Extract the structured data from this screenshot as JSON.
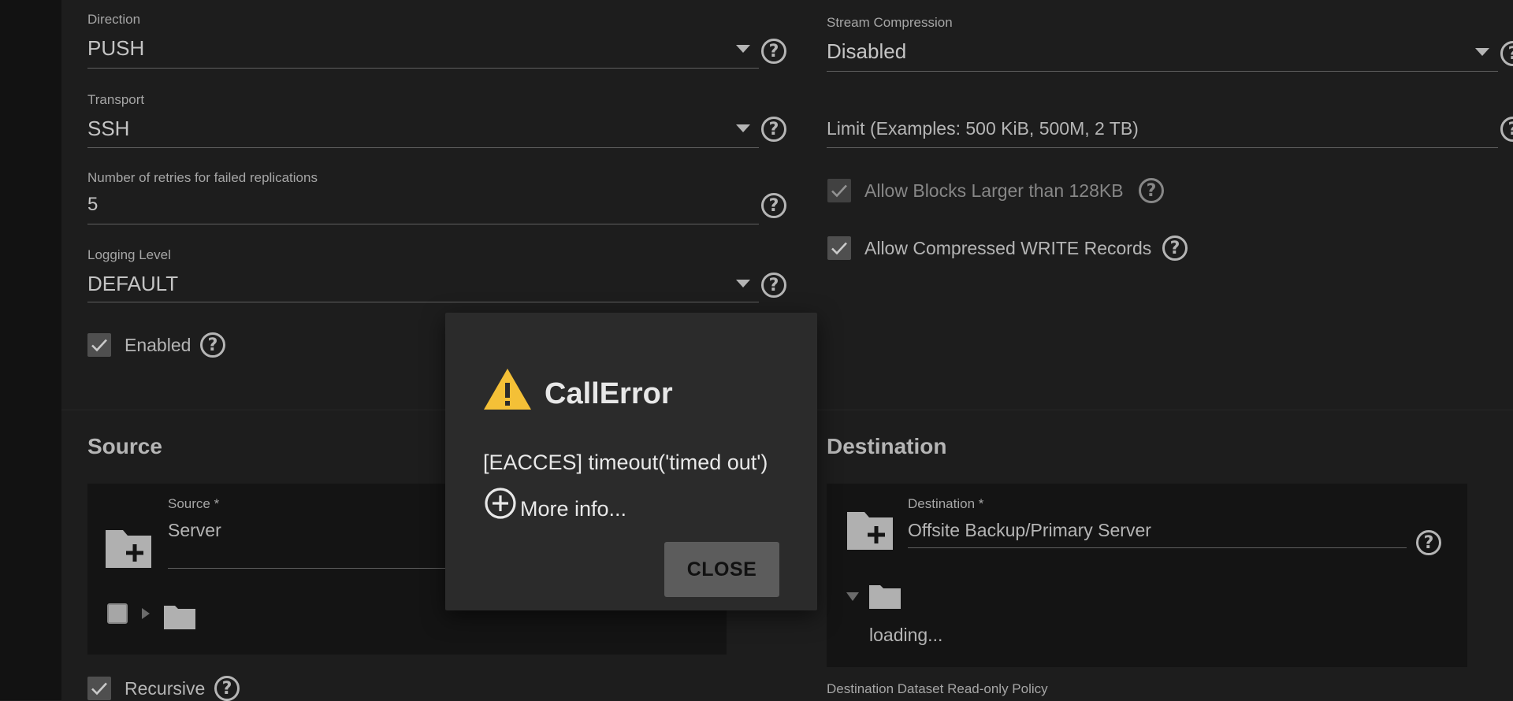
{
  "general": {
    "direction": {
      "label": "Direction",
      "value": "PUSH"
    },
    "transport": {
      "label": "Transport",
      "value": "SSH"
    },
    "retries": {
      "label": "Number of retries for failed replications",
      "value": "5"
    },
    "logging": {
      "label": "Logging Level",
      "value": "DEFAULT"
    },
    "enabled": {
      "label": "Enabled",
      "checked": true
    }
  },
  "compression": {
    "stream": {
      "label": "Stream Compression",
      "value": "Disabled"
    },
    "limit": {
      "placeholder": "Limit (Examples: 500 KiB, 500M, 2 TB)"
    },
    "large_blocks": {
      "label": "Allow Blocks Larger than 128KB",
      "checked": true,
      "disabled": true
    },
    "compressed_write": {
      "label": "Allow Compressed WRITE Records",
      "checked": true
    }
  },
  "source": {
    "title": "Source",
    "field_label": "Source *",
    "field_value": "Server",
    "recursive": {
      "label": "Recursive",
      "checked": true
    }
  },
  "destination": {
    "title": "Destination",
    "field_label": "Destination *",
    "field_value": "Offsite Backup/Primary Server",
    "loading_text": "loading...",
    "readonly_policy_label": "Destination Dataset Read-only Policy"
  },
  "dialog": {
    "title": "CallError",
    "message": "[EACCES] timeout('timed out')",
    "more_info": "More info...",
    "close_label": "CLOSE"
  },
  "colors": {
    "background": "#212121",
    "dialog": "#2b2b2b",
    "warning": "#f4c037",
    "button": "#5c5c5c"
  },
  "icons": {
    "help": "?",
    "dialog": "warning-icon",
    "more_info": "plus-circle-icon",
    "folder_add": "create-new-folder-icon",
    "folder": "folder-icon",
    "dropdown": "arrow-drop-down-icon"
  }
}
